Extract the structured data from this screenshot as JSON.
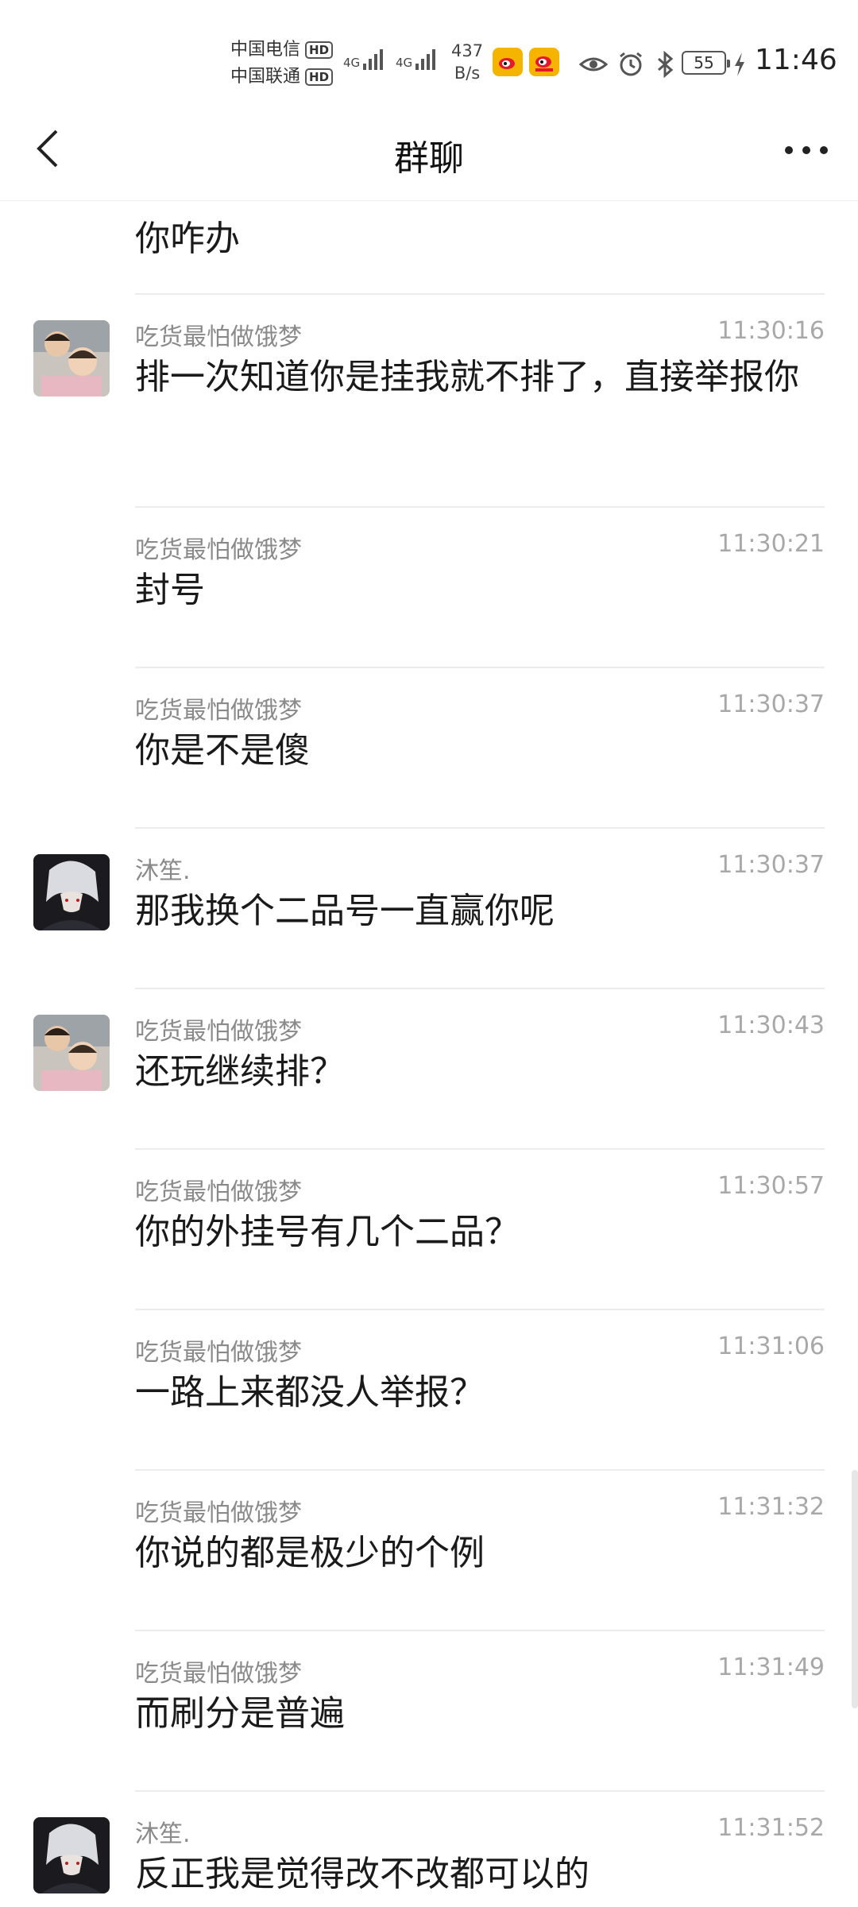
{
  "status_bar": {
    "carrier1": "中国电信",
    "carrier2": "中国联通",
    "hd_label": "HD",
    "net1": "4G",
    "net2": "4G",
    "speed_value": "437",
    "speed_unit": "B/s",
    "battery": "55",
    "time": "11:46"
  },
  "header": {
    "title": "群聊"
  },
  "messages": [
    {
      "sender": "",
      "time": "",
      "text": "你咋办"
    },
    {
      "sender": "吃货最怕做饿梦",
      "time": "11:30:16",
      "text": "排一次知道你是挂我就不排了，直接举报你"
    },
    {
      "sender": "吃货最怕做饿梦",
      "time": "11:30:21",
      "text": "封号"
    },
    {
      "sender": "吃货最怕做饿梦",
      "time": "11:30:37",
      "text": "你是不是傻"
    },
    {
      "sender": "沐笙.",
      "time": "11:30:37",
      "text": "那我换个二品号一直赢你呢"
    },
    {
      "sender": "吃货最怕做饿梦",
      "time": "11:30:43",
      "text": "还玩继续排？"
    },
    {
      "sender": "吃货最怕做饿梦",
      "time": "11:30:57",
      "text": "你的外挂号有几个二品？"
    },
    {
      "sender": "吃货最怕做饿梦",
      "time": "11:31:06",
      "text": "一路上来都没人举报？"
    },
    {
      "sender": "吃货最怕做饿梦",
      "time": "11:31:32",
      "text": "你说的都是极少的个例"
    },
    {
      "sender": "吃货最怕做饿梦",
      "time": "11:31:49",
      "text": "而刷分是普遍"
    },
    {
      "sender": "沐笙.",
      "time": "11:31:52",
      "text": "反正我是觉得改不改都可以的"
    }
  ]
}
